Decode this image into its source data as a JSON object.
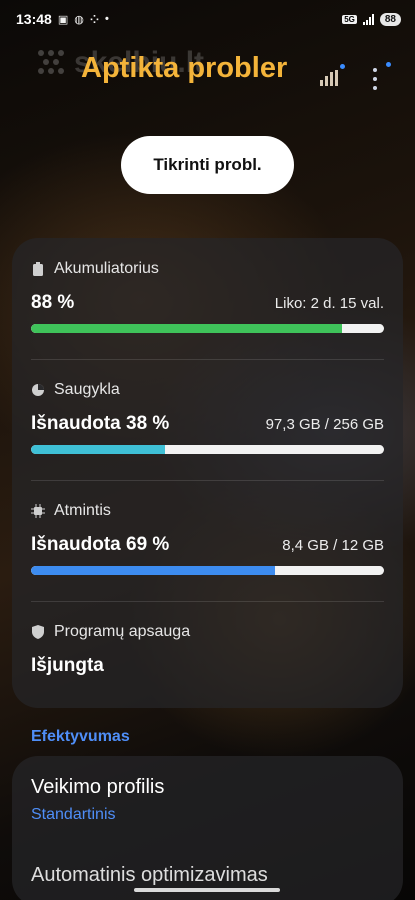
{
  "status_bar": {
    "time": "13:48",
    "network": "5G",
    "battery": "88"
  },
  "header": {
    "watermark": "skelbiu.lt",
    "title": "Aptikta probler"
  },
  "check_button": {
    "label": "Tikrinti probl."
  },
  "battery": {
    "label": "Akumuliatorius",
    "value": "88 %",
    "detail": "Liko: 2 d. 15 val.",
    "percent": 88,
    "color": "#3fc35a"
  },
  "storage": {
    "label": "Saugykla",
    "value": "Išnaudota 38 %",
    "detail": "97,3 GB / 256 GB",
    "percent": 38,
    "color": "#3fc0d6"
  },
  "memory": {
    "label": "Atmintis",
    "value": "Išnaudota 69 %",
    "detail": "8,4 GB / 12 GB",
    "percent": 69,
    "color": "#3d8cf0"
  },
  "app_protection": {
    "label": "Programų apsauga",
    "value": "Išjungta"
  },
  "efficiency": {
    "section_label": "Efektyvumas",
    "profile_title": "Veikimo profilis",
    "profile_value": "Standartinis",
    "next_item": "Automatinis optimizavimas"
  },
  "colors": {
    "accent_title": "#f4b43a",
    "accent_blue": "#4f8ef7"
  }
}
